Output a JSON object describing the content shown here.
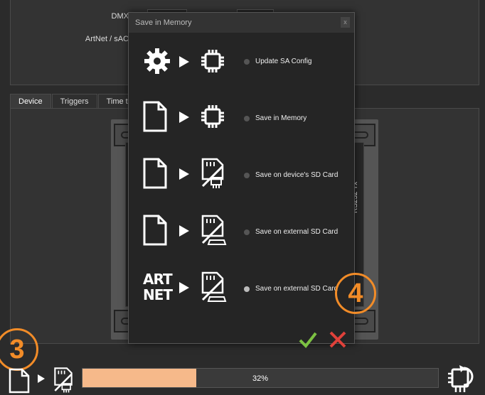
{
  "config": {
    "dmx_label": "DMX",
    "artnet_label": "ArtNet / sAC"
  },
  "tabs": [
    {
      "label": "Device"
    },
    {
      "label": "Triggers"
    },
    {
      "label": "Time trig"
    }
  ],
  "device": {
    "side_text": "RS232 Tx"
  },
  "dialog": {
    "title": "Save in Memory",
    "close_label": "x",
    "options": [
      {
        "label": "Update SA Config",
        "checked": false,
        "source_icon": "gear-icon",
        "target_icon": "chip-icon"
      },
      {
        "label": "Save in Memory",
        "checked": false,
        "source_icon": "file-icon",
        "target_icon": "chip-icon"
      },
      {
        "label": "Save on device's SD Card",
        "checked": false,
        "source_icon": "file-icon",
        "target_icon": "sd-card-chip-icon"
      },
      {
        "label": "Save on external SD Card",
        "checked": false,
        "source_icon": "file-icon",
        "target_icon": "sd-card-external-icon"
      },
      {
        "label": "Save on external SD Card",
        "checked": true,
        "source_icon": "artnet-text-icon",
        "target_icon": "sd-card-external-icon"
      }
    ],
    "artnet_icon_text": [
      "ART",
      "NET"
    ],
    "ok_icon": "checkmark-icon",
    "cancel_icon": "cross-icon",
    "ok_color": "#7cc142",
    "cancel_color": "#e0413a"
  },
  "badges": {
    "step3": "3",
    "step4": "4",
    "color": "#f28c28"
  },
  "progress": {
    "value": 0.32,
    "text": "32%",
    "fill_color": "#f6b98a"
  },
  "bottom_icons": [
    "file-icon",
    "play-arrow-icon",
    "sd-card-chip-icon",
    "chip-reset-icon"
  ]
}
